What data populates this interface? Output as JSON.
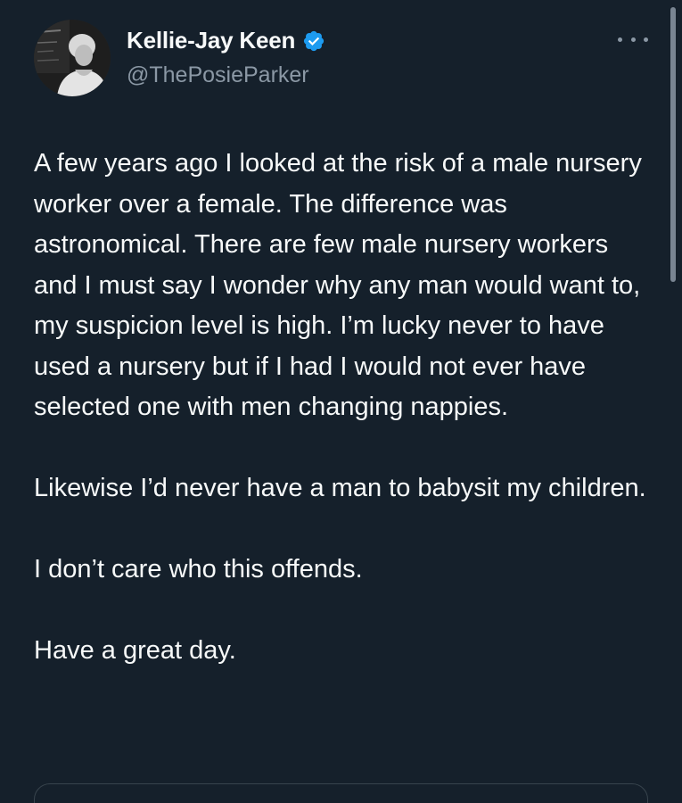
{
  "author": {
    "display_name": "Kellie-Jay Keen",
    "handle": "@ThePosieParker",
    "verified_icon": "verified-badge-icon",
    "verified_color": "#1d9bf0"
  },
  "more_icon": "more-horizontal-icon",
  "tweet": {
    "paragraphs": [
      "A few years ago I looked at the risk of a male nursery worker over a female.  The difference was astronomical.  There are few male nursery workers and I must say I wonder why any man would want to, my suspicion level is high.  I’m lucky never to have used a nursery but if I had I would not ever have selected one with men changing nappies.",
      "Likewise I’d never have a man to babysit my children.",
      "I don’t care who this offends.",
      "Have a great day."
    ]
  },
  "theme": {
    "background": "#15202b",
    "text": "#f7f9f9",
    "secondary_text": "#8b98a5"
  }
}
